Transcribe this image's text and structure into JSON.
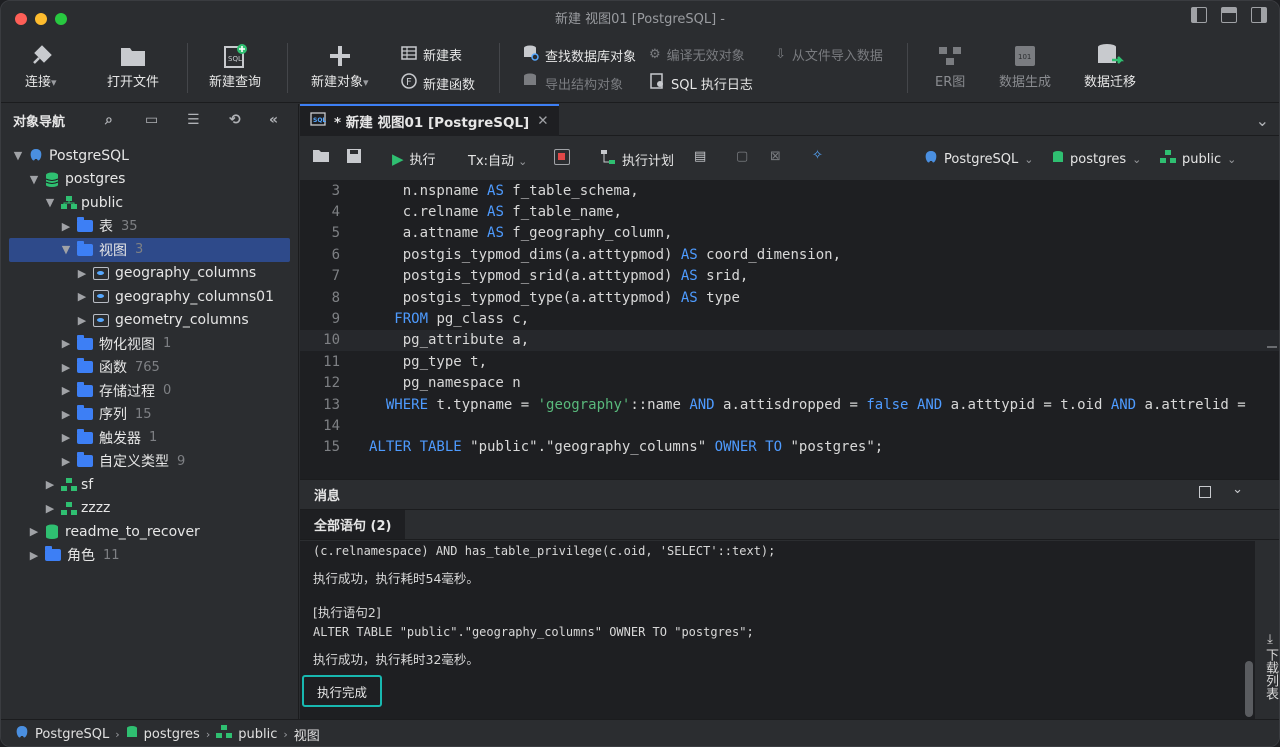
{
  "window": {
    "title": "新建 视图01 [PostgreSQL]  -"
  },
  "toolbar": {
    "connect": "连接",
    "open_file": "打开文件",
    "new_query": "新建查询",
    "new_object": "新建对象",
    "new_table": "新建表",
    "new_function": "新建函数",
    "find_db_object": "查找数据库对象",
    "compile_invalid": "编译无效对象",
    "import_from_file": "从文件导入数据",
    "export_structure": "导出结构对象",
    "sql_log": "SQL 执行日志",
    "er": "ER图",
    "data_gen": "数据生成",
    "data_migrate": "数据迁移"
  },
  "nav": {
    "title": "对象导航",
    "tree": [
      {
        "label": "PostgreSQL",
        "count": ""
      },
      {
        "label": "postgres",
        "count": ""
      },
      {
        "label": "public",
        "count": ""
      },
      {
        "label": "表",
        "count": "35"
      },
      {
        "label": "视图",
        "count": "3"
      },
      {
        "label": "geography_columns",
        "count": ""
      },
      {
        "label": "geography_columns01",
        "count": ""
      },
      {
        "label": "geometry_columns",
        "count": ""
      },
      {
        "label": "物化视图",
        "count": "1"
      },
      {
        "label": "函数",
        "count": "765"
      },
      {
        "label": "存储过程",
        "count": "0"
      },
      {
        "label": "序列",
        "count": "15"
      },
      {
        "label": "触发器",
        "count": "1"
      },
      {
        "label": "自定义类型",
        "count": "9"
      },
      {
        "label": "sf",
        "count": ""
      },
      {
        "label": "zzzz",
        "count": ""
      },
      {
        "label": "readme_to_recover",
        "count": ""
      },
      {
        "label": "角色",
        "count": "11"
      }
    ]
  },
  "editor": {
    "tab_label": "* 新建 视图01 [PostgreSQL]",
    "run": "执行",
    "tx": "Tx:自动",
    "plan": "执行计划",
    "conn": "PostgreSQL",
    "db": "postgres",
    "schema": "public",
    "lines": [
      {
        "n": "3",
        "t": "    n.nspname AS f_table_schema,"
      },
      {
        "n": "4",
        "t": "    c.relname AS f_table_name,"
      },
      {
        "n": "5",
        "t": "    a.attname AS f_geography_column,"
      },
      {
        "n": "6",
        "t": "    postgis_typmod_dims(a.atttypmod) AS coord_dimension,"
      },
      {
        "n": "7",
        "t": "    postgis_typmod_srid(a.atttypmod) AS srid,"
      },
      {
        "n": "8",
        "t": "    postgis_typmod_type(a.atttypmod) AS type"
      },
      {
        "n": "9",
        "t": "   FROM pg_class c,"
      },
      {
        "n": "10",
        "t": "    pg_attribute a,"
      },
      {
        "n": "11",
        "t": "    pg_type t,"
      },
      {
        "n": "12",
        "t": "    pg_namespace n"
      },
      {
        "n": "13",
        "t": "  WHERE t.typname = 'geography'::name AND a.attisdropped = false AND a.atttypid = t.oid AND a.attrelid ="
      },
      {
        "n": "14",
        "t": ""
      },
      {
        "n": "15",
        "t": "ALTER TABLE \"public\".\"geography_columns\" OWNER TO \"postgres\";"
      }
    ]
  },
  "messages": {
    "title": "消息",
    "tab": "全部语句 (2)",
    "lines": [
      "(c.relnamespace) AND has_table_privilege(c.oid, 'SELECT'::text);",
      "执行成功，执行耗时54毫秒。",
      "[执行语句2]",
      "ALTER TABLE \"public\".\"geography_columns\" OWNER TO \"postgres\";",
      "执行成功，执行耗时32毫秒。"
    ],
    "done": "执行完成",
    "download_list": "下载列表"
  },
  "status": {
    "conn": "PostgreSQL",
    "db": "postgres",
    "schema": "public",
    "item": "视图"
  }
}
